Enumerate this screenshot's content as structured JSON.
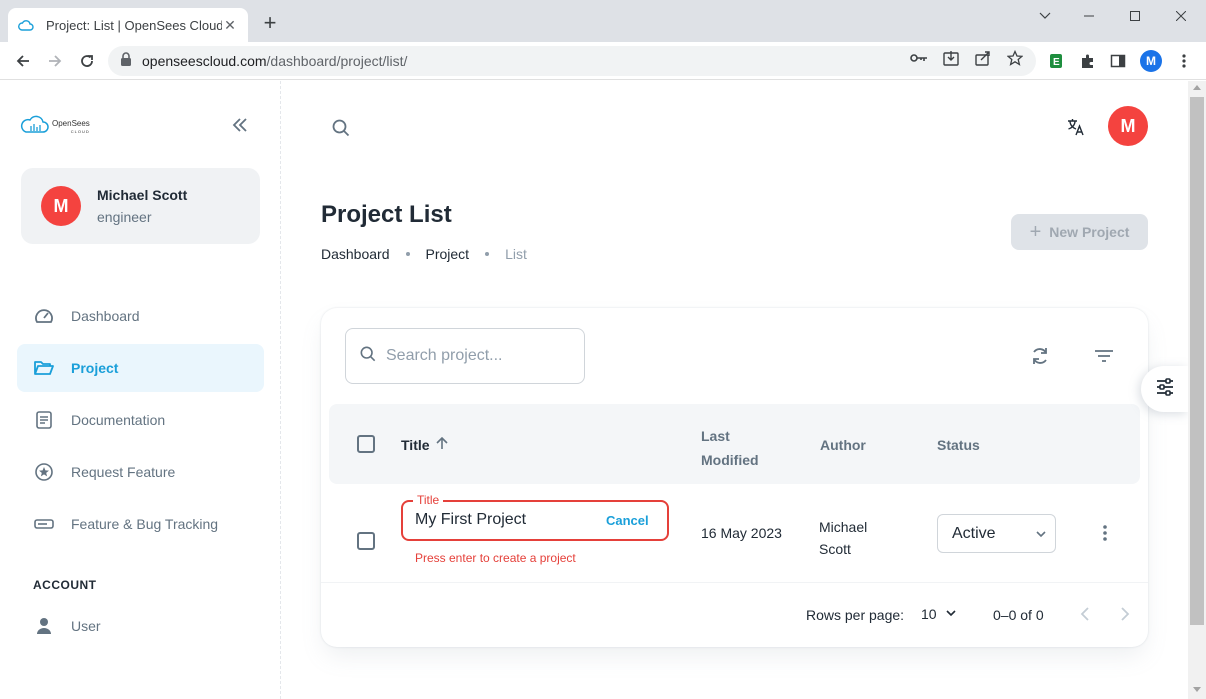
{
  "browser": {
    "tab_title": "Project: List | OpenSees Cloud",
    "url_domain": "openseescloud.com",
    "url_path": "/dashboard/project/list/",
    "profile_initial": "M"
  },
  "sidebar": {
    "logo_name": "OpenSees",
    "logo_sub": "CLOUD",
    "account": {
      "initial": "M",
      "name": "Michael Scott",
      "role": "engineer"
    },
    "items": [
      {
        "label": "Dashboard",
        "icon": "dashboard-gauge-icon"
      },
      {
        "label": "Project",
        "icon": "folder-open-icon",
        "active": true
      },
      {
        "label": "Documentation",
        "icon": "document-icon"
      },
      {
        "label": "Request Feature",
        "icon": "star-circle-icon"
      },
      {
        "label": "Feature & Bug Tracking",
        "icon": "ticket-icon"
      }
    ],
    "subheader": "ACCOUNT",
    "user_item": {
      "label": "User",
      "icon": "user-icon"
    }
  },
  "header": {
    "avatar_initial": "M"
  },
  "page": {
    "title": "Project List",
    "breadcrumb": [
      "Dashboard",
      "Project",
      "List"
    ],
    "new_button": "New Project"
  },
  "table": {
    "search_placeholder": "Search project...",
    "columns": {
      "title": "Title",
      "last_modified_1": "Last",
      "last_modified_2": "Modified",
      "author": "Author",
      "status": "Status"
    },
    "row": {
      "title_legend": "Title",
      "title_value": "My First Project",
      "cancel": "Cancel",
      "helper": "Press enter to create a project",
      "date": "16 May 2023",
      "author_first": "Michael",
      "author_last": "Scott",
      "status": "Active"
    },
    "pagination": {
      "rows_per_page_label": "Rows per page:",
      "rows_per_page": "10",
      "range": "0–0 of 0"
    }
  },
  "colors": {
    "accent": "#1a9fd9",
    "error": "#e5403a",
    "avatar": "#f4433f"
  }
}
